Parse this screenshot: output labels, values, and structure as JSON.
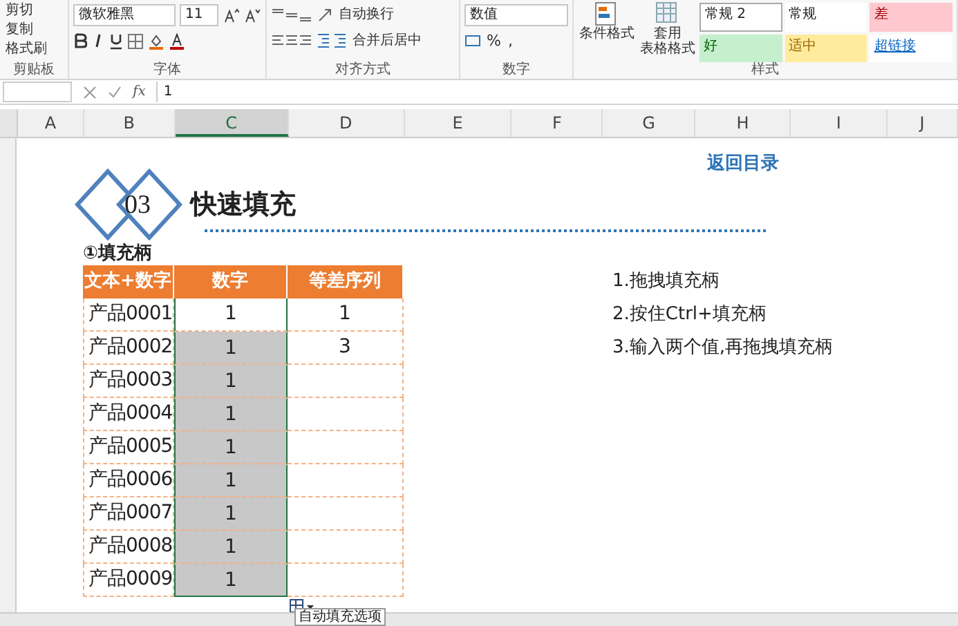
{
  "ribbon": {
    "clipboard": {
      "items": [
        "剪切",
        "复制",
        "格式刷"
      ],
      "label": "剪贴板"
    },
    "font": {
      "name": "微软雅黑",
      "size": "11",
      "label": "字体"
    },
    "alignment": {
      "wrap": "自动换行",
      "merge": "合并后居中",
      "label": "对齐方式"
    },
    "number": {
      "format": "数值",
      "percent": "%",
      "comma": ",",
      "label": "数字"
    },
    "styles": {
      "conditional": "条件格式",
      "table_format": [
        "套用",
        "表格格式"
      ],
      "label": "样式",
      "cells": [
        {
          "text": "常规 2",
          "kind": "normal2"
        },
        {
          "text": "常规",
          "kind": "normal"
        },
        {
          "text": "差",
          "kind": "bad"
        },
        {
          "text": "好",
          "kind": "good"
        },
        {
          "text": "适中",
          "kind": "neutral"
        },
        {
          "text": "超链接",
          "kind": "link"
        }
      ]
    }
  },
  "formula_bar": {
    "function_label": "fx",
    "value": "1"
  },
  "columns": [
    {
      "label": "A",
      "selected": false
    },
    {
      "label": "B",
      "selected": false
    },
    {
      "label": "C",
      "selected": true
    },
    {
      "label": "D",
      "selected": false
    },
    {
      "label": "E",
      "selected": false
    },
    {
      "label": "F",
      "selected": false
    },
    {
      "label": "G",
      "selected": false
    },
    {
      "label": "H",
      "selected": false
    },
    {
      "label": "I",
      "selected": false
    },
    {
      "label": "J",
      "selected": false
    }
  ],
  "sheet": {
    "back_link": "返回目录",
    "section_number": "03",
    "title": "快速填充",
    "subtitle": "①填充柄",
    "table": {
      "columns": [
        "文本+数字",
        "数字",
        "等差序列"
      ],
      "rows": [
        {
          "label": "产品0001",
          "number": "1",
          "series": "1",
          "selected": false
        },
        {
          "label": "产品0002",
          "number": "1",
          "series": "3",
          "selected": true
        },
        {
          "label": "产品0003",
          "number": "1",
          "series": "",
          "selected": true
        },
        {
          "label": "产品0004",
          "number": "1",
          "series": "",
          "selected": true
        },
        {
          "label": "产品0005",
          "number": "1",
          "series": "",
          "selected": true
        },
        {
          "label": "产品0006",
          "number": "1",
          "series": "",
          "selected": true
        },
        {
          "label": "产品0007",
          "number": "1",
          "series": "",
          "selected": true
        },
        {
          "label": "产品0008",
          "number": "1",
          "series": "",
          "selected": true
        },
        {
          "label": "产品0009",
          "number": "1",
          "series": "",
          "selected": true
        }
      ]
    },
    "steps": [
      "1.拖拽填充柄",
      "2.按住Ctrl+填充柄",
      "3.输入两个值,再拖拽填充柄"
    ],
    "fill_options_tooltip": "自动填充选项"
  }
}
